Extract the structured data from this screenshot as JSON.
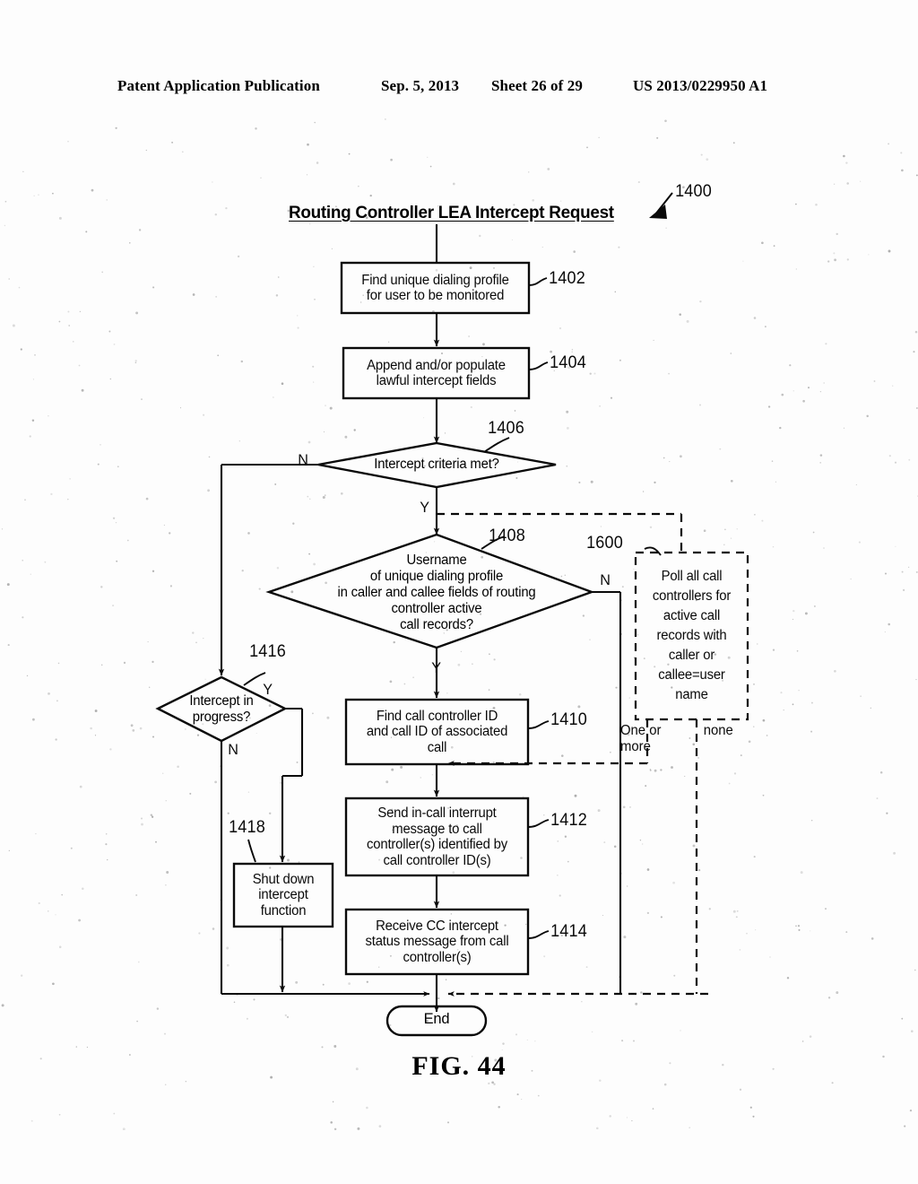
{
  "header": {
    "publication": "Patent Application Publication",
    "date": "Sep. 5, 2013",
    "sheet": "Sheet 26 of 29",
    "patent_number": "US 2013/0229950 A1"
  },
  "figure": {
    "caption": "FIG. 44",
    "flow_title": "Routing Controller LEA Intercept Request",
    "diagram_ref": "1400"
  },
  "nodes": {
    "n1402": {
      "ref": "1402",
      "text": "Find unique dialing profile\nfor user to be monitored"
    },
    "n1404": {
      "ref": "1404",
      "text": "Append and/or populate\nlawful intercept fields"
    },
    "n1406": {
      "ref": "1406",
      "text": "Intercept criteria met?"
    },
    "n1408": {
      "ref": "1408",
      "text": "Username\nof unique dialing profile\nin caller and callee fields of routing\ncontroller active\ncall records?"
    },
    "n1410": {
      "ref": "1410",
      "text": "Find call controller ID\nand call ID of associated\ncall"
    },
    "n1412": {
      "ref": "1412",
      "text": "Send in-call interrupt\nmessage to call\ncontroller(s) identified by\ncall controller ID(s)"
    },
    "n1414": {
      "ref": "1414",
      "text": "Receive CC intercept\nstatus message from call\ncontroller(s)"
    },
    "n1416": {
      "ref": "1416",
      "text": "Intercept in\nprogress?"
    },
    "n1418": {
      "ref": "1418",
      "text": "Shut down\nintercept\nfunction"
    },
    "n1600": {
      "ref": "1600",
      "text": "Poll all call\ncontrollers for\nactive call\nrecords with\ncaller or\ncallee=user\nname"
    },
    "end": {
      "text": "End"
    }
  },
  "branch_labels": {
    "n1406_no": "N",
    "n1408_yes": "Y",
    "n1408_no": "N",
    "n1416_yes": "Y",
    "n1416_no": "N",
    "n1600_some": "One or\nmore",
    "n1600_none": "none"
  },
  "colors": {
    "ink": "#0a0a0a",
    "paper": "#fdfdfd"
  }
}
